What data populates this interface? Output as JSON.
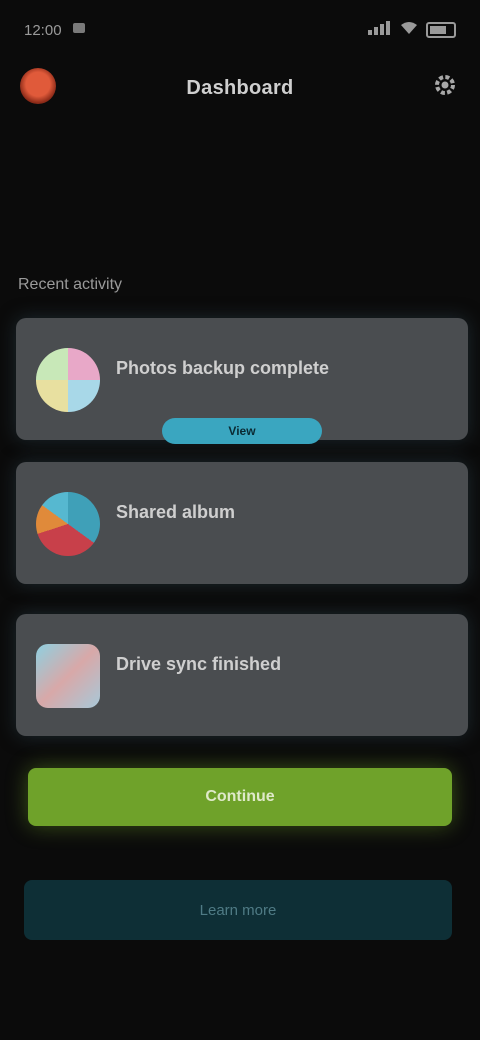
{
  "status_bar": {
    "time": "12:00",
    "icons": [
      "notification-icon",
      "signal-icon",
      "wifi-icon",
      "battery-icon"
    ]
  },
  "header": {
    "title": "Dashboard",
    "logo_icon": "app-logo-icon",
    "settings_icon": "gear-icon"
  },
  "section": {
    "title": "Recent activity"
  },
  "cards": [
    {
      "title": "Photos backup complete",
      "subtitle": "",
      "badge": "View",
      "icon": "photos-icon"
    },
    {
      "title": "Shared album",
      "subtitle": "",
      "icon": "pie-album-icon"
    },
    {
      "title": "Drive sync finished",
      "subtitle": "",
      "icon": "drive-icon"
    }
  ],
  "actions": {
    "primary_label": "Continue",
    "secondary_label": "Learn more"
  },
  "colors": {
    "background": "#0b0b0b",
    "card": "#4a4d50",
    "primary": "#6fa22a",
    "secondary": "#0e2f36",
    "badge": "#3aa6c0"
  }
}
